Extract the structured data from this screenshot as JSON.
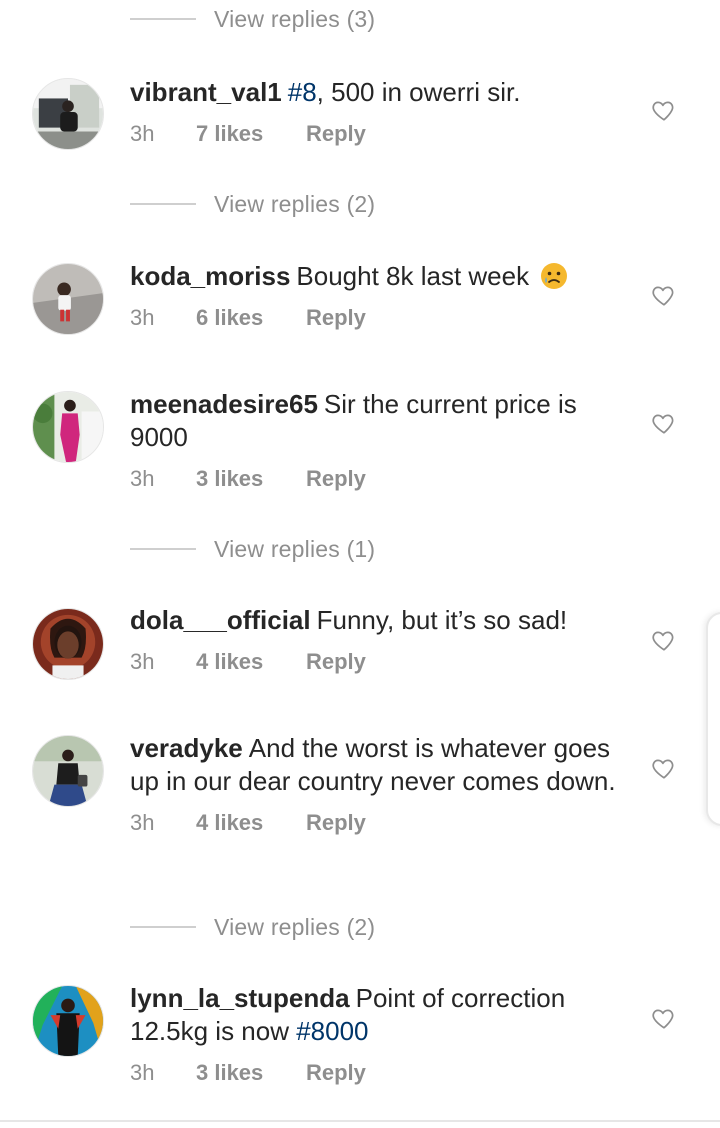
{
  "view_replies": [
    "View replies (3)",
    "View replies (2)",
    "View replies (1)",
    "View replies (2)"
  ],
  "comments": [
    {
      "username": "vibrant_val1",
      "hashtag": "#8",
      "text": ", 500 in owerri sir.",
      "time": "3h",
      "likes": "7 likes",
      "reply": "Reply"
    },
    {
      "username": "koda_moriss",
      "text": "Bought 8k last week",
      "emoji": "crying-face",
      "time": "3h",
      "likes": "6 likes",
      "reply": "Reply"
    },
    {
      "username": "meenadesire65",
      "text": "Sir the current price is 9000",
      "time": "3h",
      "likes": "3 likes",
      "reply": "Reply"
    },
    {
      "username": "dola___official",
      "text": "Funny, but it’s so sad!",
      "time": "3h",
      "likes": "4 likes",
      "reply": "Reply"
    },
    {
      "username": "veradyke",
      "text": "And the worst is whatever goes up in our dear country never comes down.",
      "time": "3h",
      "likes": "4 likes",
      "reply": "Reply"
    },
    {
      "username": "lynn_la_stupenda",
      "text": "Point of correction 12.5kg is now ",
      "hashtag": "#8000",
      "time": "3h",
      "likes": "3 likes",
      "reply": "Reply"
    }
  ],
  "icons": {
    "like": "heart-outline-icon"
  },
  "colors": {
    "hashtag": "#003569",
    "secondary_text": "#8e8e8e",
    "primary_text": "#262626"
  }
}
